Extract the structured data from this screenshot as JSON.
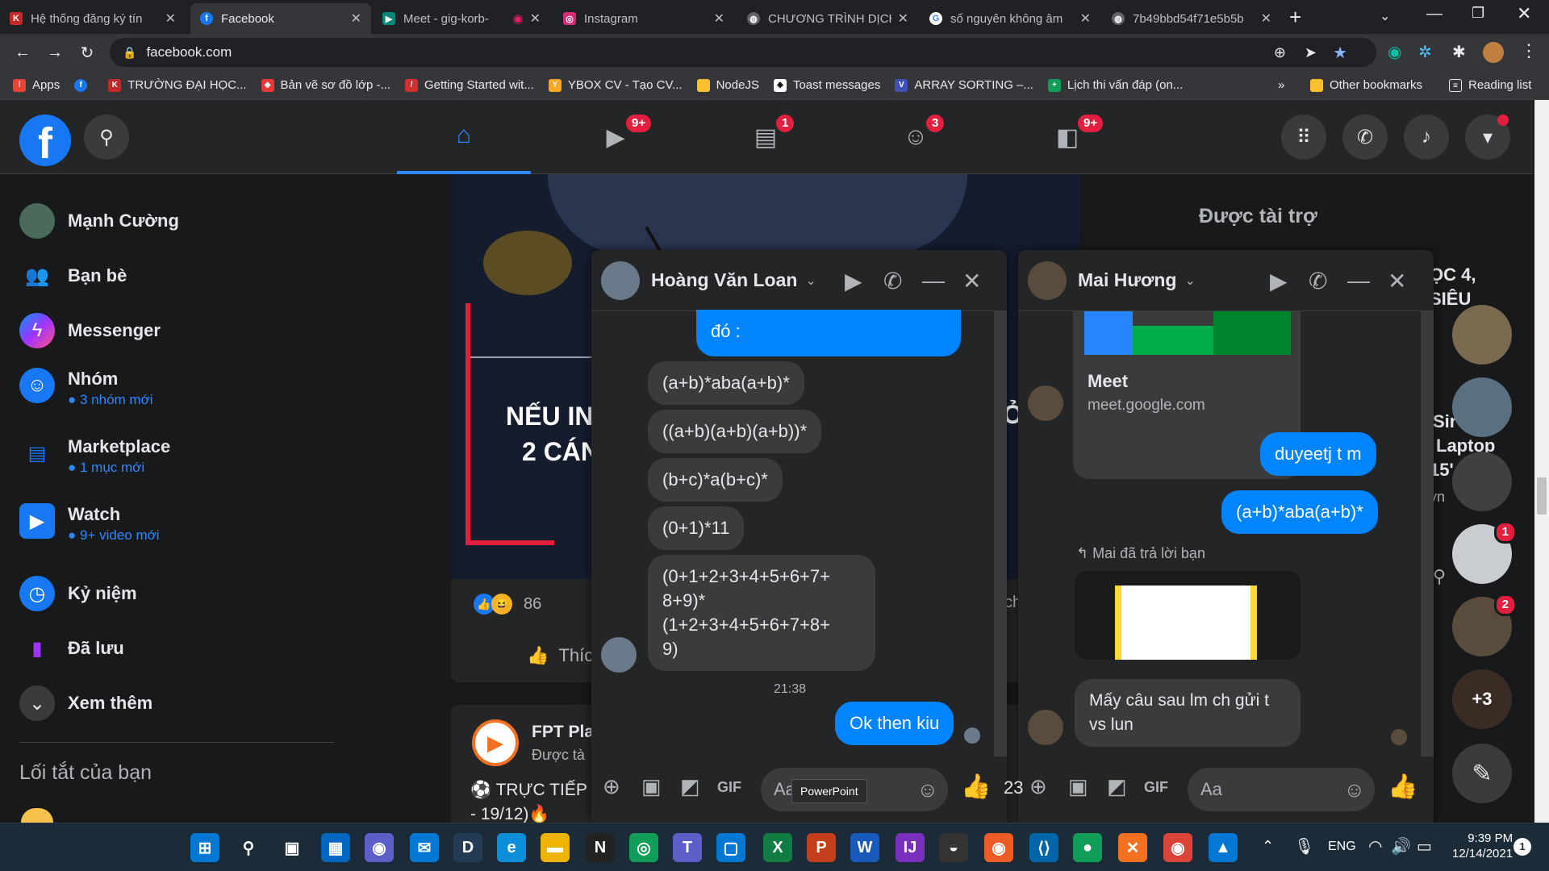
{
  "browser": {
    "tabs": [
      {
        "title": "Hệ thống đăng ký tín",
        "icon": "kl-icon",
        "color": "#c62828"
      },
      {
        "title": "Facebook",
        "icon": "facebook-icon",
        "color": "#1877f2",
        "active": true
      },
      {
        "title": "Meet - gig-korb-",
        "icon": "meet-icon",
        "color": "#00897b"
      },
      {
        "title": "Instagram",
        "icon": "instagram-icon",
        "color": "#d62976"
      },
      {
        "title": "CHƯƠNG TRÌNH DỊCH",
        "icon": "globe-icon",
        "color": "#5f6368"
      },
      {
        "title": "số nguyên không âm",
        "icon": "google-icon",
        "color": "#4285f4"
      },
      {
        "title": "7b49bbd54f71e5b5b",
        "icon": "globe-icon",
        "color": "#5f6368"
      }
    ],
    "url": "facebook.com",
    "bookmarks": [
      {
        "label": "Apps",
        "color": "#ea4335"
      },
      {
        "label": "",
        "color": "#1877f2"
      },
      {
        "label": "TRƯỜNG ĐẠI HỌC...",
        "color": "#c62828"
      },
      {
        "label": "Bản vẽ sơ đồ lớp -...",
        "color": "#e53935"
      },
      {
        "label": "Getting Started wit...",
        "color": "#d32f2f"
      },
      {
        "label": "YBOX CV - Tạo CV...",
        "color": "#f9a825"
      },
      {
        "label": "NodeJS",
        "color": "#fbc02d"
      },
      {
        "label": "Toast messages",
        "color": "#fff"
      },
      {
        "label": "ARRAY SORTING –...",
        "color": "#3f51b5"
      },
      {
        "label": "Lịch thi vấn đáp (on...",
        "color": "#0f9d58"
      }
    ],
    "bookmarks_more": "»",
    "other_bookmarks": "Other bookmarks",
    "reading_list": "Reading list"
  },
  "facebook": {
    "nav_badges": {
      "watch": "9+",
      "marketplace": "1",
      "groups": "3",
      "gaming": "9+"
    },
    "left_nav": [
      {
        "label": "Mạnh Cường",
        "sub": "",
        "icon": "avatar",
        "color": "#4a6b5a"
      },
      {
        "label": "Bạn bè",
        "sub": "",
        "icon": "friends-icon",
        "color": "#1877f2"
      },
      {
        "label": "Messenger",
        "sub": "",
        "icon": "messenger-icon",
        "color": "#a033ff"
      },
      {
        "label": "Nhóm",
        "sub": "● 3 nhóm mới",
        "icon": "groups-icon",
        "color": "#1877f2"
      },
      {
        "label": "Marketplace",
        "sub": "● 1 mục mới",
        "icon": "marketplace-icon",
        "color": "#1877f2"
      },
      {
        "label": "Watch",
        "sub": "● 9+ video mới",
        "icon": "watch-icon",
        "color": "#1877f2"
      },
      {
        "label": "Kỷ niệm",
        "sub": "",
        "icon": "memories-icon",
        "color": "#1877f2"
      },
      {
        "label": "Đã lưu",
        "sub": "",
        "icon": "saved-icon",
        "color": "#a033ff"
      },
      {
        "label": "Xem thêm",
        "sub": "",
        "icon": "chevron-down-icon",
        "color": "#3a3b3c"
      }
    ],
    "shortcuts_title": "Lối tắt của bạn",
    "post": {
      "overlay_text_1": "NẾU IN",
      "overlay_text_2": "2 CÁN",
      "reaction_count": "86",
      "like_label": "Thíc",
      "edge_letter_1": "Ở",
      "edge_letter_2": "ch"
    },
    "post2": {
      "author": "FPT Pla",
      "sub": "Được tà",
      "text_1": "⚽ TRỰC TIẾP",
      "text_2": "- 19/12)🔥"
    },
    "sponsored": "Được tài trợ",
    "right_partial": [
      "ỌC 4,",
      "SIÊU",
      "Sir",
      "Laptop",
      "15'",
      "vn"
    ],
    "contact_badges": {
      "c4": "1",
      "c5": "2",
      "more": "+3"
    },
    "contact_colors": [
      "#7a6a50",
      "#5a7080",
      "#404040",
      "#c9ccd1",
      "#5a4c3c",
      "#3a2c24"
    ]
  },
  "chat1": {
    "name": "Hoàng Văn Loan",
    "messages": [
      {
        "text": "đó :",
        "dir": "out"
      },
      {
        "text": "(a+b)*aba(a+b)*",
        "dir": "in"
      },
      {
        "text": "((a+b)(a+b)(a+b))*",
        "dir": "in"
      },
      {
        "text": "(b+c)*a(b+c)*",
        "dir": "in"
      },
      {
        "text": "(0+1)*11",
        "dir": "in"
      },
      {
        "text": "(0+1+2+3+4+5+6+7+\n8+9)*\n(1+2+3+4+5+6+7+8+\n9)",
        "dir": "in"
      },
      {
        "text": "Ok then kiu",
        "dir": "out"
      }
    ],
    "timestamp": "21:38",
    "placeholder": "Aa",
    "tooltip": "PowerPoint"
  },
  "chat2": {
    "name": "Mai Hương",
    "link_title": "Meet",
    "link_domain": "meet.google.com",
    "messages": [
      {
        "text": "duyeetj t m",
        "dir": "out"
      },
      {
        "text": "(a+b)*aba(a+b)*",
        "dir": "out"
      },
      {
        "text": "Mấy câu sau lm ch gửi t\nvs lun",
        "dir": "in"
      }
    ],
    "reply_label": "↰ Mai đã trả lời bạn",
    "placeholder": "Aa",
    "edge_number": "23"
  },
  "taskbar": {
    "apps": [
      {
        "name": "start-icon",
        "glyph": "⊞",
        "color": "#0078d4"
      },
      {
        "name": "search-icon",
        "glyph": "⚲",
        "color": "transparent"
      },
      {
        "name": "task-view-icon",
        "glyph": "▣",
        "color": "transparent"
      },
      {
        "name": "widgets-icon",
        "glyph": "▦",
        "color": "#0067c0"
      },
      {
        "name": "chat-icon",
        "glyph": "◉",
        "color": "#5b5fc7"
      },
      {
        "name": "mail-icon",
        "glyph": "✉",
        "color": "#0078d4"
      },
      {
        "name": "dev-icon",
        "glyph": "D",
        "color": "#243b55"
      },
      {
        "name": "edge-icon",
        "glyph": "e",
        "color": "#0c8fd9"
      },
      {
        "name": "explorer-icon",
        "glyph": "▬",
        "color": "#f0b400"
      },
      {
        "name": "notion-icon",
        "glyph": "N",
        "color": "#222"
      },
      {
        "name": "app-icon",
        "glyph": "◎",
        "color": "#0f9d58"
      },
      {
        "name": "teams-icon",
        "glyph": "T",
        "color": "#5b5fc7"
      },
      {
        "name": "app2-icon",
        "glyph": "▢",
        "color": "#0078d4"
      },
      {
        "name": "excel-icon",
        "glyph": "X",
        "color": "#107c41"
      },
      {
        "name": "powerpoint-icon",
        "glyph": "P",
        "color": "#c43e1c"
      },
      {
        "name": "word-icon",
        "glyph": "W",
        "color": "#185abc"
      },
      {
        "name": "intellij-icon",
        "glyph": "IJ",
        "color": "#7b2fbf"
      },
      {
        "name": "app3-icon",
        "glyph": "◒",
        "color": "#333"
      },
      {
        "name": "postman-icon",
        "glyph": "◉",
        "color": "#ef5b25"
      },
      {
        "name": "vscode-icon",
        "glyph": "⟨⟩",
        "color": "#0065a9"
      },
      {
        "name": "app4-icon",
        "glyph": "●",
        "color": "#0f9d58"
      },
      {
        "name": "app5-icon",
        "glyph": "✕",
        "color": "#f37021"
      },
      {
        "name": "chrome-icon",
        "glyph": "◉",
        "color": "#db4437"
      },
      {
        "name": "photos-icon",
        "glyph": "▲",
        "color": "#0078d4"
      }
    ],
    "lang": "ENG",
    "time": "9:39 PM",
    "date": "12/14/2021",
    "notif_count": "1"
  },
  "colors": {
    "accent": "#1877f2",
    "badge": "#e41e3f",
    "bubble_out": "#0084ff"
  }
}
